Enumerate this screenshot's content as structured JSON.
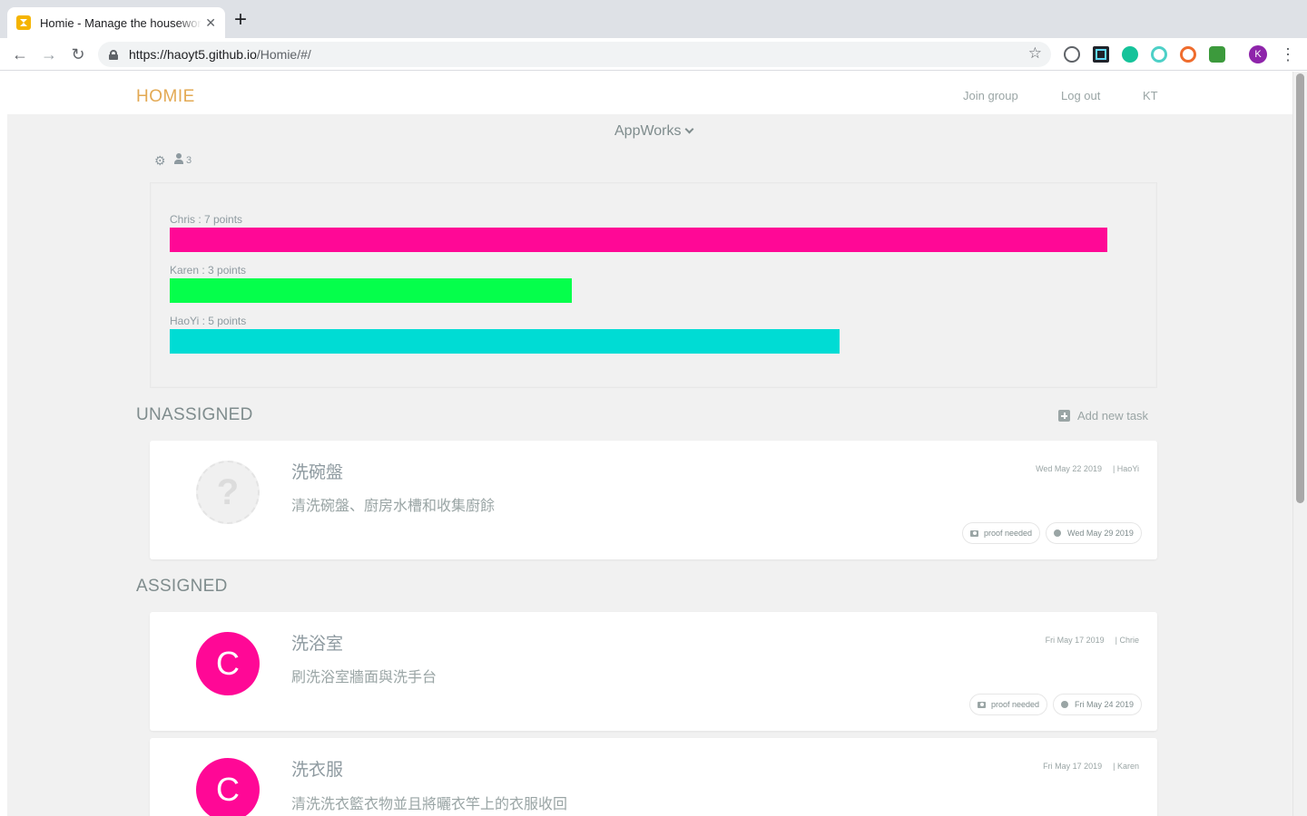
{
  "browser": {
    "tab_title": "Homie - Manage the housework",
    "tab_close": "✕",
    "new_tab": "+",
    "url_host": "https://haoyt5.github.io",
    "url_path": "/Homie/#/",
    "profile_initial": "K"
  },
  "header": {
    "logo": "HOMIE",
    "nav": {
      "join_group": "Join group",
      "log_out": "Log out",
      "user": "KT"
    }
  },
  "group": {
    "name": "AppWorks",
    "member_count": "3"
  },
  "points": {
    "max_points": 7,
    "members": [
      {
        "label": "Chris : 7 points",
        "points": 7,
        "color": "#ff0896"
      },
      {
        "label": "Karen : 3 points",
        "points": 3,
        "color": "#05ff4b"
      },
      {
        "label": "HaoYi : 5 points",
        "points": 5,
        "color": "#00dcd4"
      }
    ]
  },
  "unassigned": {
    "title": "UNASSIGNED",
    "add_task": "Add new task",
    "tasks": [
      {
        "avatar": "?",
        "title": "洗碗盤",
        "description": "清洗碗盤、廚房水槽和收集廚餘",
        "created": "Wed May 22 2019",
        "creator": "| HaoYi",
        "proof": "proof needed",
        "due": "Wed May 29 2019"
      }
    ]
  },
  "assigned": {
    "title": "ASSIGNED",
    "tasks": [
      {
        "avatar": "C",
        "title": "洗浴室",
        "description": "刷洗浴室牆面與洗手台",
        "created": "Fri May 17 2019",
        "creator": "| Chrie",
        "proof": "proof needed",
        "due": "Fri May 24 2019"
      },
      {
        "avatar": "C",
        "title": "洗衣服",
        "description": "清洗洗衣籃衣物並且將曬衣竿上的衣服收回",
        "created": "Fri May 17 2019",
        "creator": "| Karen"
      }
    ]
  }
}
